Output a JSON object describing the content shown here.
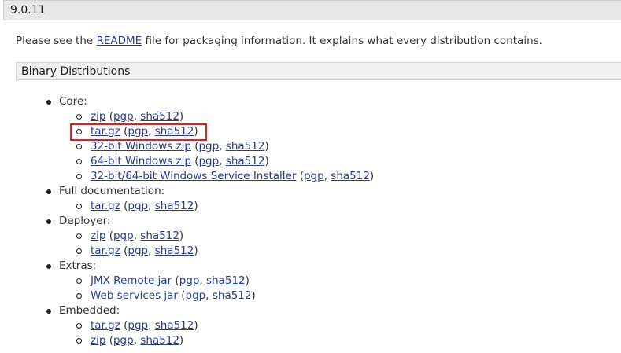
{
  "version": "9.0.11",
  "intro": {
    "before": "Please see the ",
    "link": "README",
    "after": " file for packaging information. It explains what every distribution contains."
  },
  "section_title": "Binary Distributions",
  "groups": [
    {
      "label": "Core:",
      "items": [
        {
          "name": "zip",
          "pgp": "pgp",
          "sha": "sha512"
        },
        {
          "name": "tar.gz",
          "pgp": "pgp",
          "sha": "sha512"
        },
        {
          "name": "32-bit Windows zip",
          "pgp": "pgp",
          "sha": "sha512"
        },
        {
          "name": "64-bit Windows zip",
          "pgp": "pgp",
          "sha": "sha512"
        },
        {
          "name": "32-bit/64-bit Windows Service Installer",
          "pgp": "pgp",
          "sha": "sha512"
        }
      ]
    },
    {
      "label": "Full documentation:",
      "items": [
        {
          "name": "tar.gz",
          "pgp": "pgp",
          "sha": "sha512"
        }
      ]
    },
    {
      "label": "Deployer:",
      "items": [
        {
          "name": "zip",
          "pgp": "pgp",
          "sha": "sha512"
        },
        {
          "name": "tar.gz",
          "pgp": "pgp",
          "sha": "sha512"
        }
      ]
    },
    {
      "label": "Extras:",
      "items": [
        {
          "name": "JMX Remote jar",
          "pgp": "pgp",
          "sha": "sha512"
        },
        {
          "name": "Web services jar",
          "pgp": "pgp",
          "sha": "sha512"
        }
      ]
    },
    {
      "label": "Embedded:",
      "items": [
        {
          "name": "tar.gz",
          "pgp": "pgp",
          "sha": "sha512"
        },
        {
          "name": "zip",
          "pgp": "pgp",
          "sha": "sha512"
        }
      ]
    }
  ],
  "colors": {
    "link": "#2a3c8c",
    "highlight": "#e41e1e"
  }
}
